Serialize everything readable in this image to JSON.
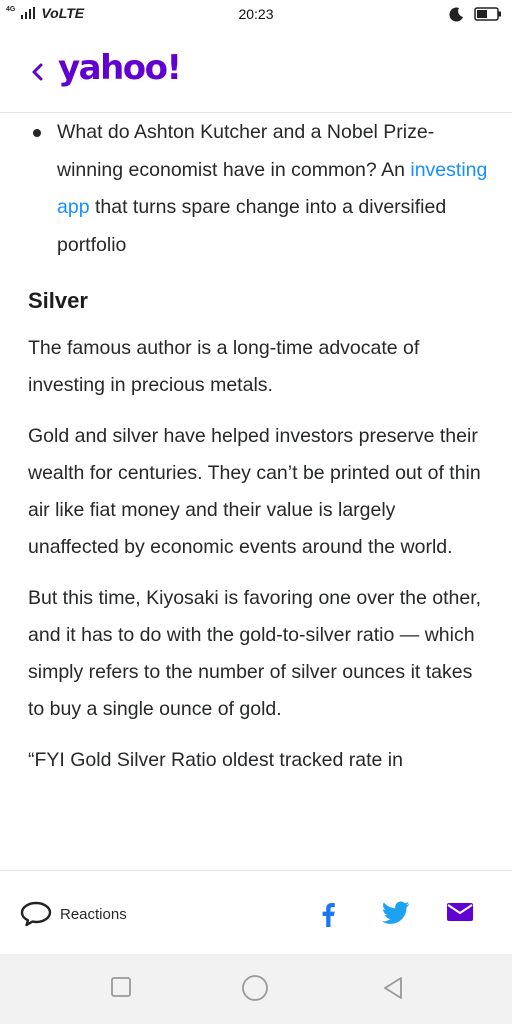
{
  "status": {
    "network": "4G",
    "carrier": "VoLTE",
    "time": "20:23"
  },
  "header": {
    "logo": "yahoo!"
  },
  "article": {
    "bullet": {
      "before": "What do Ashton Kutcher and a Nobel Prize-winning economist have in common? An ",
      "link": "investing app",
      "after": " that turns spare change into a diversified portfolio"
    },
    "heading": "Silver",
    "paragraphs": [
      "The famous author is a long-time advocate of investing in precious metals.",
      "Gold and silver have helped investors preserve their wealth for centuries. They can’t be printed out of thin air like fiat money and their value is largely unaffected by economic events around the world.",
      "But this time, Kiyosaki is favoring one over the other, and it has to do with the gold-to-silver ratio — which simply refers to the number of silver ounces it takes to buy a single ounce of gold.",
      "“FYI Gold Silver Ratio oldest tracked rate in"
    ]
  },
  "footer": {
    "reactions_label": "Reactions"
  },
  "colors": {
    "brand": "#6001d2",
    "link": "#188fff",
    "facebook": "#1877f2",
    "twitter": "#1da1f2",
    "mail": "#6001d2"
  }
}
